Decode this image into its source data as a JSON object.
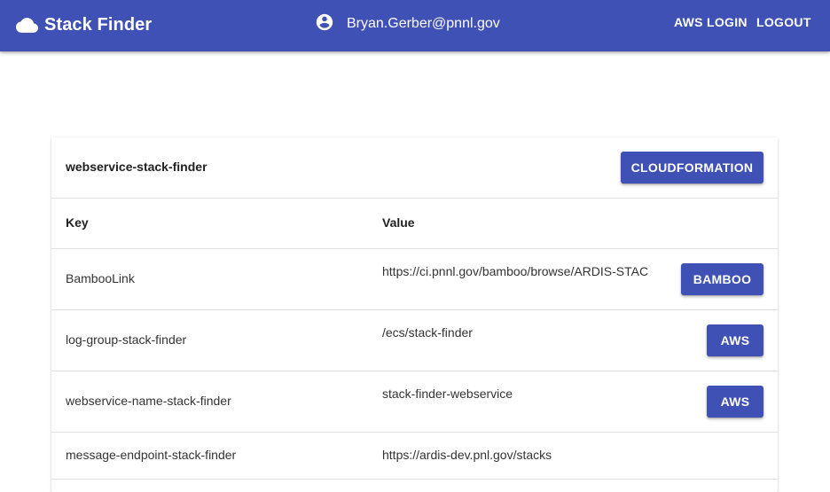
{
  "app": {
    "title": "Stack Finder",
    "icon": "cloud-icon",
    "accent_color": "#3f51b5"
  },
  "user": {
    "icon": "account-circle-icon",
    "email": "Bryan.Gerber@pnnl.gov"
  },
  "nav": {
    "aws_login_label": "AWS LOGIN",
    "logout_label": "LOGOUT"
  },
  "stack": {
    "name": "webservice-stack-finder",
    "cloudformation_label": "CLOUDFORMATION",
    "columns": {
      "key": "Key",
      "value": "Value"
    },
    "rows": [
      {
        "key": "BambooLink",
        "value": "https://ci.pnnl.gov/bamboo/browse/ARDIS-STAC",
        "button": "BAMBOO"
      },
      {
        "key": "log-group-stack-finder",
        "value": "/ecs/stack-finder",
        "button": "AWS"
      },
      {
        "key": "webservice-name-stack-finder",
        "value": "stack-finder-webservice",
        "button": "AWS"
      },
      {
        "key": "message-endpoint-stack-finder",
        "value": "https://ardis-dev.pnl.gov/stacks",
        "button": ""
      }
    ]
  }
}
